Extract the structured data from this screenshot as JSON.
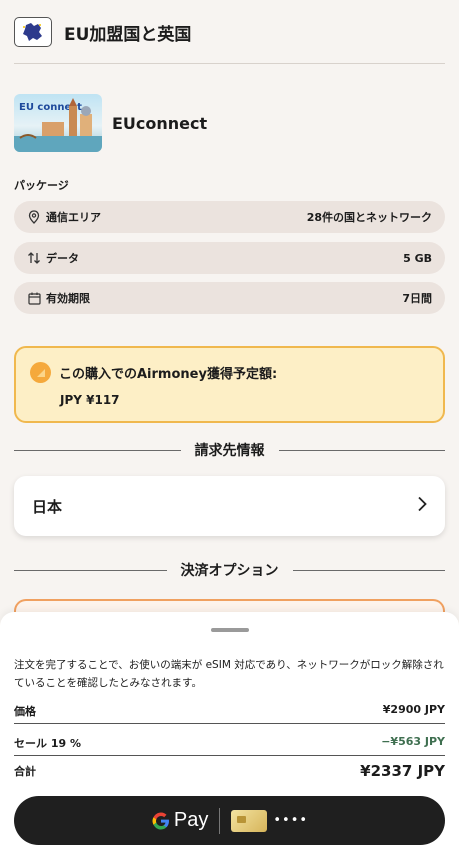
{
  "header": {
    "title": "EU加盟国と英国",
    "flag_icon": "eu-map-icon"
  },
  "product": {
    "thumb_label": "EU connect",
    "name": "EUconnect"
  },
  "package": {
    "section_label": "パッケージ",
    "rows": [
      {
        "icon": "location-pin-icon",
        "label": "通信エリア",
        "value": "28件の国とネットワーク"
      },
      {
        "icon": "data-arrows-icon",
        "label": "データ",
        "value": "5 GB"
      },
      {
        "icon": "calendar-icon",
        "label": "有効期限",
        "value": "7日間"
      }
    ]
  },
  "reward": {
    "label": "この購入でのAirmoney獲得予定額:",
    "amount": "JPY ¥117"
  },
  "billing": {
    "heading": "請求先情報",
    "country": "日本"
  },
  "payment_options": {
    "heading": "決済オプション"
  },
  "sheet": {
    "notice": "注文を完了することで、お使いの端末が eSIM 対応であり、ネットワークがロック解除されていることを確認したとみなされます。",
    "price_label": "価格",
    "price_value": "¥2900 JPY",
    "discount_label": "セール 19 %",
    "discount_value": "−¥563 JPY",
    "total_label": "合計",
    "total_value": "¥2337 JPY"
  },
  "gpay": {
    "pay_text": "Pay",
    "card_mask": "••••"
  },
  "colors": {
    "accent_orange": "#f0b84e",
    "reward_bg": "#fdefc6",
    "row_bg": "#ebe3de",
    "discount_green": "#3f6f50",
    "gpay_bg": "#1f1f1f"
  }
}
